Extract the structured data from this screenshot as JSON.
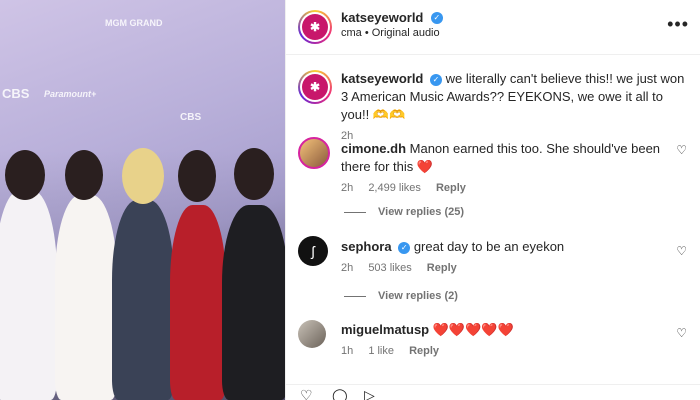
{
  "media": {
    "backdrop": {
      "cbs_a": "CBS",
      "paramount_a": "Paramount+",
      "cbs_b": "CBS",
      "mgm": "MGM GRAND"
    }
  },
  "post": {
    "username": "katseyeworld",
    "subline": "cma • Original audio",
    "caption_user": "katseyeworld",
    "caption": "we literally can't believe this!! we just won 3 American Music Awards?? EYEKONS, we owe it all to you!! 🫶🫶",
    "caption_time": "2h"
  },
  "comments": [
    {
      "user": "cimone.dh",
      "text": "Manon earned this too. She should've been there for this ❤️",
      "time": "2h",
      "likes": "2,499 likes",
      "reply": "Reply",
      "view_replies": "View replies (25)"
    },
    {
      "user": "sephora",
      "text": "great day to be an eyekon",
      "time": "2h",
      "likes": "503 likes",
      "reply": "Reply",
      "view_replies": "View replies (2)"
    },
    {
      "user": "miguelmatusp",
      "text": "❤️❤️❤️❤️❤️",
      "time": "1h",
      "likes": "1 like",
      "reply": "Reply"
    }
  ],
  "colors": {
    "verified": "#3897f0",
    "brand_avatar": "#c8176b",
    "heart": "#e0245e"
  },
  "icons": {
    "more": "more-options-icon",
    "like": "heart-outline-icon",
    "verified": "verified-badge-icon"
  }
}
